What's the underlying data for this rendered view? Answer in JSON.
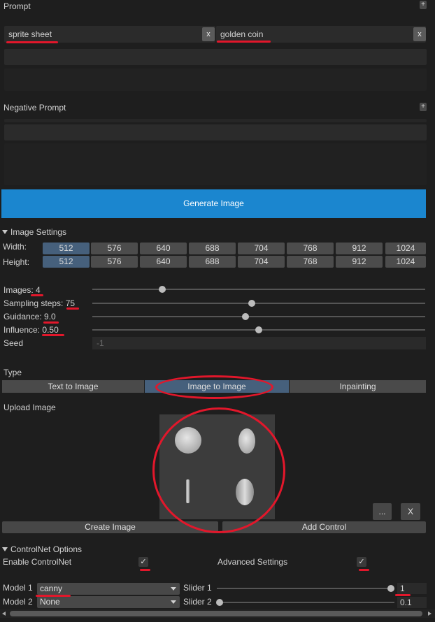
{
  "prompt": {
    "title": "Prompt",
    "tags": [
      "sprite sheet",
      "golden coin"
    ],
    "remove_label": "x"
  },
  "negative_prompt": {
    "title": "Negative Prompt"
  },
  "generate_button": "Generate Image",
  "image_settings": {
    "title": "Image Settings",
    "width_label": "Width:",
    "height_label": "Height:",
    "sizes": [
      "512",
      "576",
      "640",
      "688",
      "704",
      "768",
      "912",
      "1024"
    ],
    "selected_width": "512",
    "selected_height": "512"
  },
  "params": {
    "images": {
      "label": "Images:",
      "value": "4",
      "fraction": 0.21
    },
    "sampling_steps": {
      "label": "Sampling steps:",
      "value": "75",
      "fraction": 0.48
    },
    "guidance": {
      "label": "Guidance:",
      "value": "9.0",
      "fraction": 0.46
    },
    "influence": {
      "label": "Influence:",
      "value": "0.50",
      "fraction": 0.5
    },
    "seed": {
      "label": "Seed",
      "value": "-1"
    }
  },
  "type": {
    "title": "Type",
    "tabs": [
      "Text to Image",
      "Image to Image",
      "Inpainting"
    ],
    "selected": "Image to Image"
  },
  "upload": {
    "title": "Upload Image",
    "browse_label": "...",
    "clear_label": "X",
    "create_image": "Create Image",
    "add_control": "Add Control"
  },
  "controlnet": {
    "title": "ControlNet Options",
    "enable_label": "Enable ControlNet",
    "advanced_label": "Advanced Settings",
    "check_mark": "✓",
    "model1_label": "Model 1",
    "model1_value": "canny",
    "model2_label": "Model 2",
    "model2_value": "None",
    "slider1_label": "Slider 1",
    "slider1_value": "1",
    "slider2_label": "Slider 2",
    "slider2_value": "0.1"
  },
  "colors": {
    "accent": "#1b86cf",
    "selected": "#46607c",
    "annotation": "#e2172b"
  }
}
